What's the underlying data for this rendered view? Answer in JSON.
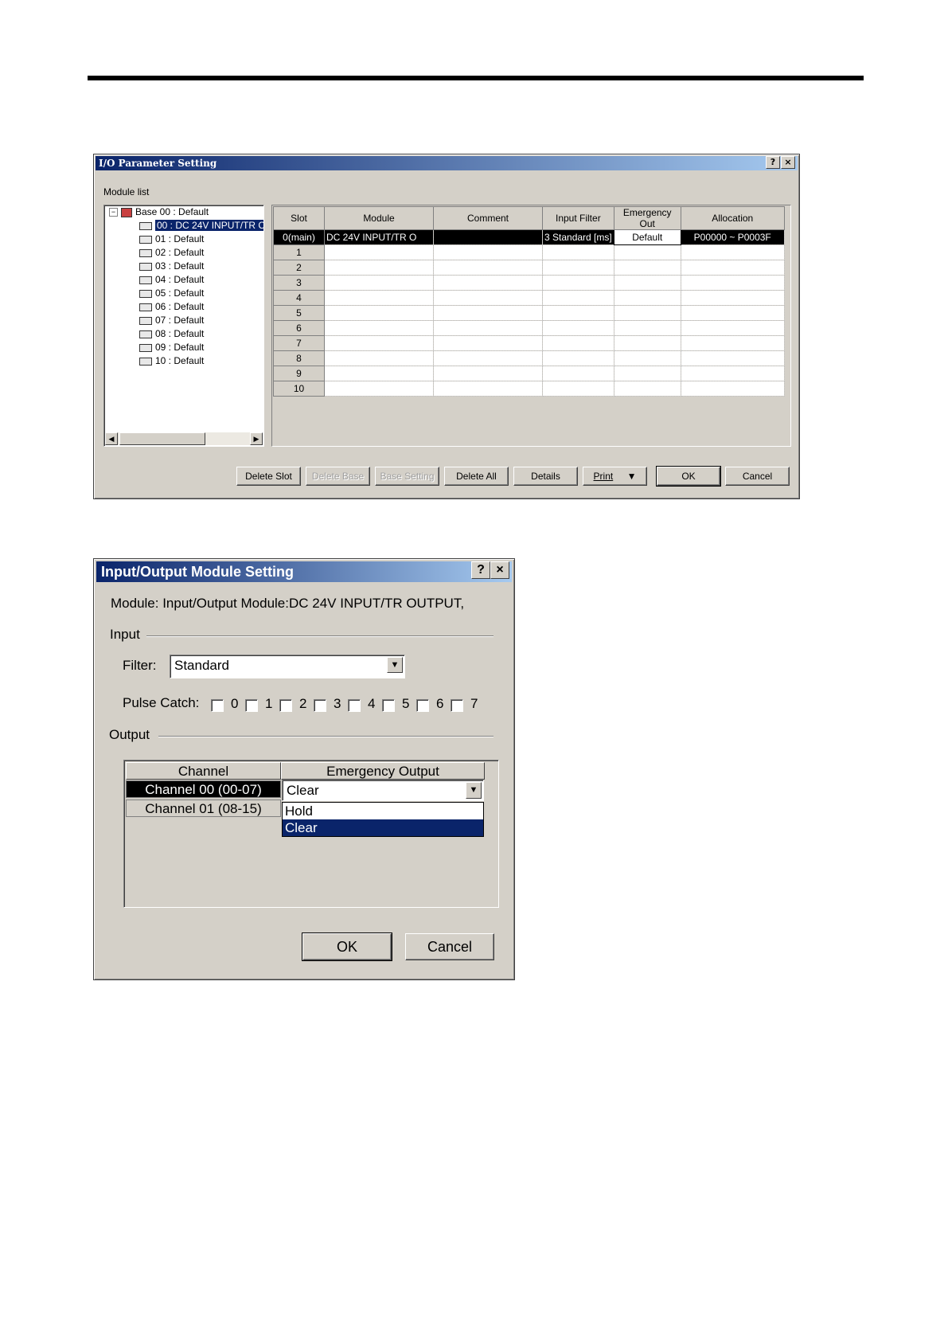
{
  "dialog1": {
    "title": "I/O Parameter Setting",
    "help": "?",
    "close": "×",
    "module_list_label": "Module list",
    "tree": {
      "root": "Base 00 : Default",
      "items": [
        "00 : DC 24V INPUT/TR C",
        "01 : Default",
        "02 : Default",
        "03 : Default",
        "04 : Default",
        "05 : Default",
        "06 : Default",
        "07 : Default",
        "08 : Default",
        "09 : Default",
        "10 : Default"
      ]
    },
    "columns": [
      "Slot",
      "Module",
      "Comment",
      "Input Filter",
      "Emergency Out",
      "Allocation"
    ],
    "rows": [
      {
        "slot": "0(main)",
        "module": "DC 24V INPUT/TR O",
        "comment": "",
        "filter": "3 Standard [ms]",
        "emergency": "Default",
        "allocation": "P00000 ~ P0003F"
      },
      {
        "slot": "1"
      },
      {
        "slot": "2"
      },
      {
        "slot": "3"
      },
      {
        "slot": "4"
      },
      {
        "slot": "5"
      },
      {
        "slot": "6"
      },
      {
        "slot": "7"
      },
      {
        "slot": "8"
      },
      {
        "slot": "9"
      },
      {
        "slot": "10"
      }
    ],
    "buttons": {
      "delete_slot": "Delete Slot",
      "delete_base": "Delete Base",
      "base_setting": "Base Setting",
      "delete_all": "Delete All",
      "details": "Details",
      "print": "Print",
      "ok": "OK",
      "cancel": "Cancel"
    }
  },
  "dialog2": {
    "title": "Input/Output Module Setting",
    "help": "?",
    "close": "×",
    "module_line": "Module:  Input/Output Module:DC 24V INPUT/TR OUTPUT,",
    "input_label": "Input",
    "filter_label": "Filter:",
    "filter_value": "Standard",
    "pulse_label": "Pulse Catch:",
    "pulse_channels": [
      "0",
      "1",
      "2",
      "3",
      "4",
      "5",
      "6",
      "7"
    ],
    "output_label": "Output",
    "table": {
      "col_channel": "Channel",
      "col_emergency": "Emergency Output",
      "channels": [
        "Channel 00 (00-07)",
        "Channel 01 (08-15)"
      ],
      "current_value": "Clear",
      "options": [
        "Hold",
        "Clear"
      ]
    },
    "ok": "OK",
    "cancel": "Cancel"
  }
}
